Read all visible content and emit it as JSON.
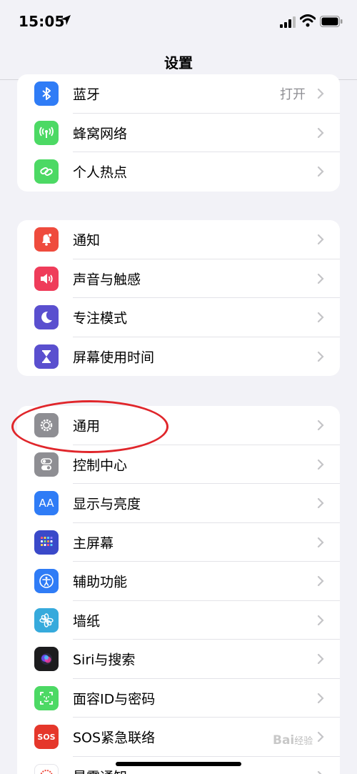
{
  "status": {
    "time": "15:05"
  },
  "nav": {
    "title": "设置"
  },
  "groups": [
    {
      "items": [
        {
          "label": "蓝牙",
          "value": "打开",
          "color": "#2f7cf6",
          "icon": "bluetooth-icon"
        },
        {
          "label": "蜂窝网络",
          "value": "",
          "color": "#4cd964",
          "icon": "cellular-icon"
        },
        {
          "label": "个人热点",
          "value": "",
          "color": "#4cd964",
          "icon": "hotspot-icon"
        }
      ]
    },
    {
      "items": [
        {
          "label": "通知",
          "value": "",
          "color": "#ef4b3d",
          "icon": "bell-icon"
        },
        {
          "label": "声音与触感",
          "value": "",
          "color": "#ef3c5a",
          "icon": "speaker-icon"
        },
        {
          "label": "专注模式",
          "value": "",
          "color": "#5a4fcf",
          "icon": "moon-icon"
        },
        {
          "label": "屏幕使用时间",
          "value": "",
          "color": "#5a4fcf",
          "icon": "hourglass-icon"
        }
      ]
    },
    {
      "items": [
        {
          "label": "通用",
          "value": "",
          "color": "#8e8e93",
          "icon": "gear-icon"
        },
        {
          "label": "控制中心",
          "value": "",
          "color": "#8e8e93",
          "icon": "toggles-icon"
        },
        {
          "label": "显示与亮度",
          "value": "",
          "color": "#2f7cf6",
          "icon": "text-size-icon",
          "glyph": "AA"
        },
        {
          "label": "主屏幕",
          "value": "",
          "color": "#3a49c9",
          "icon": "home-screen-icon"
        },
        {
          "label": "辅助功能",
          "value": "",
          "color": "#2f7cf6",
          "icon": "accessibility-icon"
        },
        {
          "label": "墙纸",
          "value": "",
          "color": "#36aadc",
          "icon": "flower-icon"
        },
        {
          "label": "Siri与搜索",
          "value": "",
          "color": "#1c1c1e",
          "icon": "siri-icon"
        },
        {
          "label": "面容ID与密码",
          "value": "",
          "color": "#4cd964",
          "icon": "face-id-icon"
        },
        {
          "label": "SOS紧急联络",
          "value": "",
          "color": "#e5372b",
          "icon": "sos-icon",
          "glyph": "SOS"
        },
        {
          "label": "暴露通知",
          "value": "",
          "color": "#ffffff",
          "icon": "exposure-icon"
        }
      ]
    }
  ],
  "watermark": {
    "brand": "Bai",
    "text": "经验"
  }
}
